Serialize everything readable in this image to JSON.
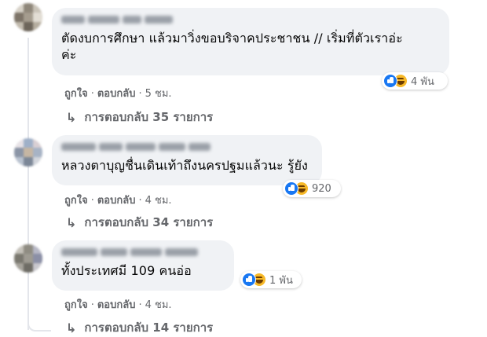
{
  "comments": [
    {
      "text": "ตัดงบการศึกษา แล้วมาวิ่งขอบริจาคประชาชน // เริ่มที่ตัวเราอ่ะ",
      "text2": "ค่ะ",
      "reaction_count": "4 พัน",
      "like_label": "ถูกใจ",
      "reply_label": "ตอบกลับ",
      "time": "5 ชม.",
      "replies_label": "การตอบกลับ 35 รายการ"
    },
    {
      "text": "หลวงตาบุญชื่นเดินเท้าถึงนครปฐมแล้วนะ รู้ยัง",
      "reaction_count": "920",
      "like_label": "ถูกใจ",
      "reply_label": "ตอบกลับ",
      "time": "4 ชม.",
      "replies_label": "การตอบกลับ 34 รายการ"
    },
    {
      "text": "ทั้งประเทศมี 109 คนอ่อ",
      "reaction_count": "1 พัน",
      "like_label": "ถูกใจ",
      "reply_label": "ตอบกลับ",
      "time": "4 ชม.",
      "replies_label": "การตอบกลับ 14 รายการ"
    }
  ],
  "separator": "·",
  "reply_arrow": "↳",
  "colors": {
    "bubble": "#f0f2f5",
    "secondary_text": "#65676b",
    "like_blue": "#1877f2",
    "haha_yellow": "#f7b928"
  },
  "icons": [
    "like-reaction-icon",
    "haha-reaction-icon",
    "reply-arrow-icon"
  ]
}
